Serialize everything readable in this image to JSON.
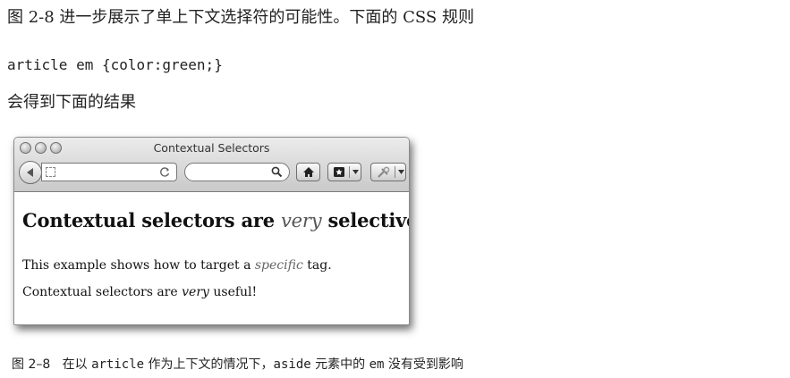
{
  "intro_text": "图 2-8 进一步展示了单上下文选择符的可能性。下面的 CSS 规则",
  "code_line": "article em {color:green;}",
  "result_text": "会得到下面的结果",
  "browser": {
    "window_title": "Contextual Selectors",
    "url_value": "",
    "search_value": "",
    "icons": [
      "back-arrow-icon",
      "favicon-icon",
      "reload-icon",
      "search-icon",
      "home-icon",
      "bookmarks-icon",
      "tools-icon"
    ],
    "content": {
      "heading_before": "Contextual selectors are ",
      "heading_em": "very",
      "heading_after": " selective",
      "p1_before": "This example shows how to target a ",
      "p1_em": "specific",
      "p1_after": " tag.",
      "p2_before": "Contextual selectors are ",
      "p2_em": "very",
      "p2_after": " useful!"
    }
  },
  "caption": {
    "label": "图 2–8",
    "part1": "在以 ",
    "code1": "article",
    "part2": " 作为上下文的情况下，",
    "code2": "aside",
    "part3": " 元素中的 ",
    "code3": "em",
    "part4": " 没有受到影响"
  }
}
